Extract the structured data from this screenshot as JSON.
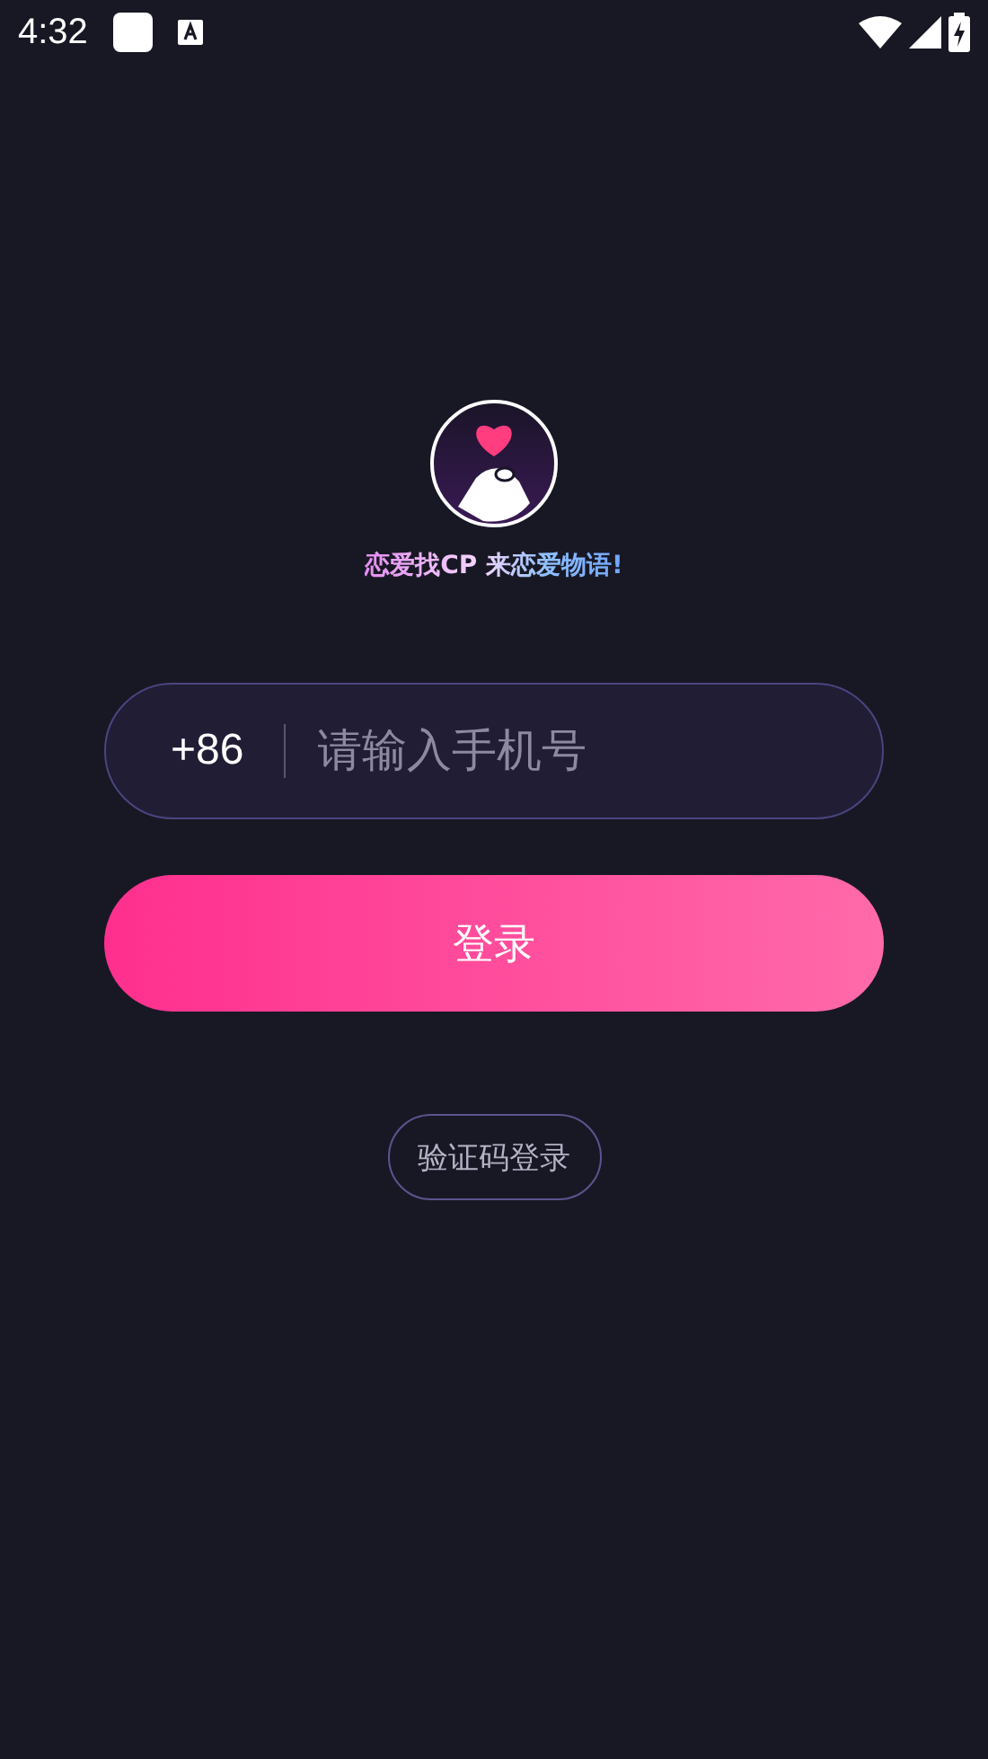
{
  "status_bar": {
    "time": "4:32"
  },
  "app": {
    "tagline": "恋爱找CP 来恋爱物语!"
  },
  "phone_field": {
    "country_code": "+86",
    "placeholder": "请输入手机号"
  },
  "login_button": {
    "label": "登录"
  },
  "code_login_button": {
    "label": "验证码登录"
  }
}
